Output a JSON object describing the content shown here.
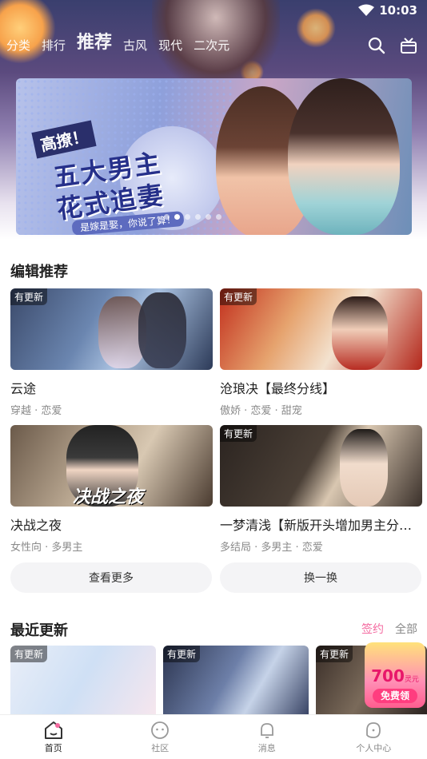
{
  "status": {
    "time": "10:03"
  },
  "top_nav": {
    "items": [
      "分类",
      "排行",
      "推荐",
      "古风",
      "现代",
      "二次元"
    ],
    "active_index": 2
  },
  "banner": {
    "tag": "高撩！",
    "line1": "五大男主",
    "line2": "花式追妻",
    "subline": "是嫁是娶，你说了算！",
    "page_count": 6,
    "active_page": 1
  },
  "editor_picks": {
    "title": "编辑推荐",
    "items": [
      {
        "badge": "有更新",
        "name": "云途",
        "tags": "穿越 · 恋爱"
      },
      {
        "badge": "有更新",
        "name": "沧琅决【最终分线】",
        "tags": "傲娇 · 恋爱 · 甜宠"
      },
      {
        "badge": "",
        "name": "决战之夜",
        "tags": "女性向 · 多男主"
      },
      {
        "badge": "有更新",
        "name": "一梦清浅【新版开头增加男主分线…",
        "tags": "多结局 · 多男主 · 恋爱"
      }
    ],
    "more_label": "查看更多",
    "refresh_label": "换一换"
  },
  "recent": {
    "title": "最近更新",
    "link_signed": "签约",
    "link_all": "全部",
    "items": [
      {
        "badge": "有更新"
      },
      {
        "badge": "有更新"
      },
      {
        "badge": "有更新"
      }
    ]
  },
  "coupon": {
    "amount": "700",
    "unit": "灵元券",
    "cta": "免费领"
  },
  "tabbar": {
    "items": [
      {
        "label": "首页",
        "icon": "home-icon"
      },
      {
        "label": "社区",
        "icon": "community-icon"
      },
      {
        "label": "消息",
        "icon": "bell-icon"
      },
      {
        "label": "个人中心",
        "icon": "profile-icon"
      }
    ],
    "active_index": 0
  },
  "colors": {
    "accent": "#f46aa0",
    "text": "#222222",
    "muted": "#8a8a8a"
  }
}
